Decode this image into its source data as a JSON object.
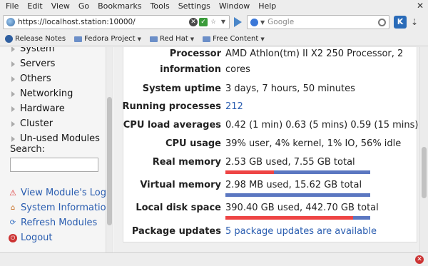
{
  "menubar": {
    "items": [
      "File",
      "Edit",
      "View",
      "Go",
      "Bookmarks",
      "Tools",
      "Settings",
      "Window",
      "Help"
    ]
  },
  "navbar": {
    "url": "https://localhost.station:10000/",
    "search_placeholder": "Google"
  },
  "bookmarks": {
    "items": [
      {
        "label": "Release Notes",
        "icon": "release-notes-icon"
      },
      {
        "label": "Fedora Project",
        "icon": "folder-icon"
      },
      {
        "label": "Red Hat",
        "icon": "folder-icon"
      },
      {
        "label": "Free Content",
        "icon": "folder-icon"
      }
    ]
  },
  "sidebar": {
    "categories": [
      "System",
      "Servers",
      "Others",
      "Networking",
      "Hardware",
      "Cluster",
      "Un-used Modules"
    ],
    "search_label": "Search:",
    "links": [
      {
        "label": "View Module's Logs",
        "icon": "warning-icon"
      },
      {
        "label": "System Information",
        "icon": "home-icon"
      },
      {
        "label": "Refresh Modules",
        "icon": "refresh-icon"
      },
      {
        "label": "Logout",
        "icon": "power-icon"
      }
    ]
  },
  "sysinfo": {
    "processor": {
      "label_1": "Processor",
      "label_2": "information",
      "value_1": "AMD Athlon(tm) II X2 250 Processor, 2",
      "value_2": "cores"
    },
    "uptime": {
      "label": "System uptime",
      "value": "3 days, 7 hours, 50 minutes"
    },
    "processes": {
      "label": "Running processes",
      "value": "212"
    },
    "load": {
      "label": "CPU load averages",
      "value": "0.42 (1 min) 0.63 (5 mins) 0.59 (15 mins)"
    },
    "cpu": {
      "label": "CPU usage",
      "value": "39% user, 4% kernel, 1% IO, 56% idle"
    },
    "real_memory": {
      "label": "Real memory",
      "value": "2.53 GB used, 7.55 GB total",
      "used_fraction": 0.335
    },
    "virtual_memory": {
      "label": "Virtual memory",
      "value": "2.98 MB used, 15.62 GB total",
      "used_fraction": 0.0002
    },
    "disk": {
      "label": "Local disk space",
      "value": "390.40 GB used, 442.70 GB total",
      "used_fraction": 0.882
    },
    "updates": {
      "label": "Package updates",
      "value": "5 package updates are available"
    }
  },
  "colors": {
    "bar_used": "#ee4444",
    "bar_free": "#5b77c1",
    "link": "#2a5db0"
  }
}
